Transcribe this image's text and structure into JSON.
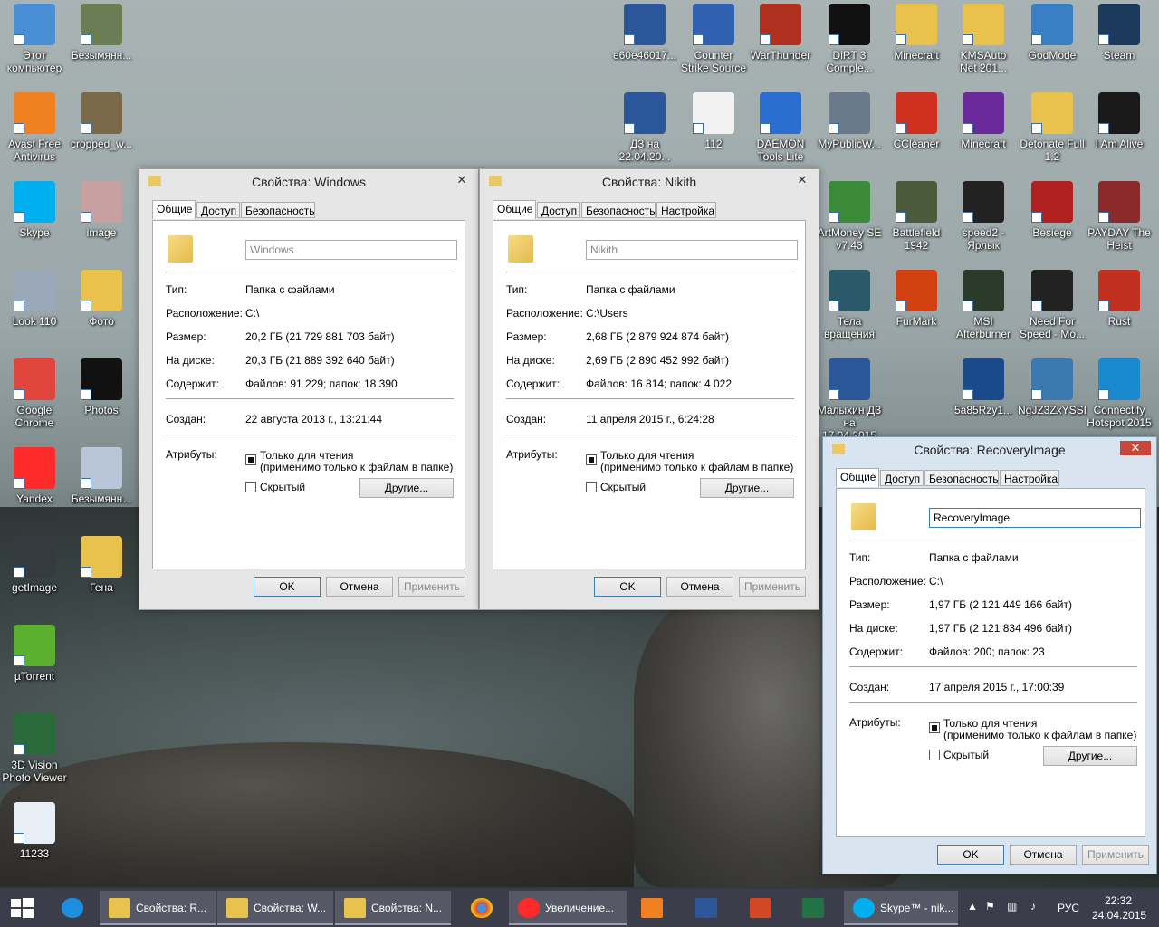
{
  "desktop": {
    "icons": [
      {
        "label": "Этот\nкомпьютер",
        "color": "#4a8fd6"
      },
      {
        "label": "Безымянн...",
        "color": "#6b7d55"
      },
      {
        "label": "Avast Free\nAntivirus",
        "color": "#f08020"
      },
      {
        "label": "cropped_w...",
        "color": "#7a6a4a"
      },
      {
        "label": "Skype",
        "color": "#00aff0"
      },
      {
        "label": "image",
        "color": "#c9a0a0"
      },
      {
        "label": "Look 110",
        "color": "#9aa8b8"
      },
      {
        "label": "Фото",
        "color": "#e9c24e"
      },
      {
        "label": "Google\nChrome",
        "color": "#e0463b"
      },
      {
        "label": "Photos",
        "color": "#111111"
      },
      {
        "label": "Yandex",
        "color": "#ff2b2b"
      },
      {
        "label": "Безымянн...",
        "color": "#b8c6d8"
      },
      {
        "label": "getImage",
        "color": "#333b40"
      },
      {
        "label": "Гена",
        "color": "#e9c24e"
      },
      {
        "label": "µTorrent",
        "color": "#5cb030"
      },
      {
        "label": "3D Vision\nPhoto Viewer",
        "color": "#2a6a3a"
      },
      {
        "label": "11233",
        "color": "#e8eef5"
      },
      {
        "label": "e60e46017...",
        "color": "#2b579a"
      },
      {
        "label": "Counter\nStrike Source",
        "color": "#3060b0"
      },
      {
        "label": "WarThunder",
        "color": "#b03020"
      },
      {
        "label": "DiRT 3\nComple...",
        "color": "#111111"
      },
      {
        "label": "Minecraft",
        "color": "#e9c24e"
      },
      {
        "label": "KMSAuto\nNet 201...",
        "color": "#e9c24e"
      },
      {
        "label": "GodMode",
        "color": "#3a7fc4"
      },
      {
        "label": "Steam",
        "color": "#1b3a5c"
      },
      {
        "label": "ДЗ на\n22.04.20...",
        "color": "#2b579a"
      },
      {
        "label": "112",
        "color": "#f2f2f2"
      },
      {
        "label": "DAEMON\nTools Lite",
        "color": "#2a6fd0"
      },
      {
        "label": "MyPublicW...",
        "color": "#6a7a8a"
      },
      {
        "label": "CCleaner",
        "color": "#d03020"
      },
      {
        "label": "Minecraft",
        "color": "#6a2a9a"
      },
      {
        "label": "Detonate Full\n1.2",
        "color": "#e9c24e"
      },
      {
        "label": "I Am Alive",
        "color": "#1a1a1a"
      },
      {
        "label": "ArtMoney SE\nv7.43",
        "color": "#3a8a3a"
      },
      {
        "label": "Battlefield\n1942",
        "color": "#4a5a3a"
      },
      {
        "label": "speed2 -\nЯрлык",
        "color": "#222222"
      },
      {
        "label": "Besiege",
        "color": "#b02020"
      },
      {
        "label": "PAYDAY The\nHeist",
        "color": "#8a2a2a"
      },
      {
        "label": "Тела\nвращения",
        "color": "#2a5a6a"
      },
      {
        "label": "FurMark",
        "color": "#d04010"
      },
      {
        "label": "MSI\nAfterburner",
        "color": "#2a3a2a"
      },
      {
        "label": "Need For\nSpeed - Mo...",
        "color": "#222222"
      },
      {
        "label": "Rust",
        "color": "#c03020"
      },
      {
        "label": "Малыхин ДЗ\nна 17.04.2015",
        "color": "#2b579a"
      },
      {
        "label": "5a85Rzy1...",
        "color": "#1a4a8a"
      },
      {
        "label": "NgJZ3ZxYSSI",
        "color": "#3a7ab0"
      },
      {
        "label": "Connectify\nHotspot 2015",
        "color": "#1a8ad0"
      }
    ]
  },
  "dialogs": {
    "windows": {
      "title": "Свойства: Windows",
      "tabs": [
        "Общие",
        "Доступ",
        "Безопасность"
      ],
      "name": "Windows",
      "type_label": "Тип:",
      "type": "Папка с файлами",
      "location_label": "Расположение:",
      "location": "C:\\",
      "size_label": "Размер:",
      "size": "20,2 ГБ (21 729 881 703 байт)",
      "ondisk_label": "На диске:",
      "ondisk": "20,3 ГБ (21 889 392 640 байт)",
      "contains_label": "Содержит:",
      "contains": "Файлов: 91 229; папок: 18 390",
      "created_label": "Создан:",
      "created": "22 августа 2013 г., 13:21:44",
      "attrs_label": "Атрибуты:",
      "readonly": "Только для чтения",
      "readonly_note": "(применимо только к файлам в папке)",
      "hidden": "Скрытый",
      "other": "Другие...",
      "ok": "OK",
      "cancel": "Отмена",
      "apply": "Применить"
    },
    "nikith": {
      "title": "Свойства: Nikith",
      "tabs": [
        "Общие",
        "Доступ",
        "Безопасность",
        "Настройка"
      ],
      "name": "Nikith",
      "type_label": "Тип:",
      "type": "Папка с файлами",
      "location_label": "Расположение:",
      "location": "C:\\Users",
      "size_label": "Размер:",
      "size": "2,68 ГБ (2 879 924 874 байт)",
      "ondisk_label": "На диске:",
      "ondisk": "2,69 ГБ (2 890 452 992 байт)",
      "contains_label": "Содержит:",
      "contains": "Файлов: 16 814; папок: 4 022",
      "created_label": "Создан:",
      "created": "11 апреля 2015 г., 6:24:28",
      "attrs_label": "Атрибуты:",
      "readonly": "Только для чтения",
      "readonly_note": "(применимо только к файлам в папке)",
      "hidden": "Скрытый",
      "other": "Другие...",
      "ok": "OK",
      "cancel": "Отмена",
      "apply": "Применить"
    },
    "recovery": {
      "title": "Свойства: RecoveryImage",
      "tabs": [
        "Общие",
        "Доступ",
        "Безопасность",
        "Настройка"
      ],
      "name": "RecoveryImage",
      "type_label": "Тип:",
      "type": "Папка с файлами",
      "location_label": "Расположение:",
      "location": "C:\\",
      "size_label": "Размер:",
      "size": "1,97 ГБ (2 121 449 166 байт)",
      "ondisk_label": "На диске:",
      "ondisk": "1,97 ГБ (2 121 834 496 байт)",
      "contains_label": "Содержит:",
      "contains": "Файлов: 200; папок: 23",
      "created_label": "Создан:",
      "created": "17 апреля 2015 г., 17:00:39",
      "attrs_label": "Атрибуты:",
      "readonly": "Только для чтения",
      "readonly_note": "(применимо только к файлам в папке)",
      "hidden": "Скрытый",
      "other": "Другие...",
      "ok": "OK",
      "cancel": "Отмена",
      "apply": "Применить"
    }
  },
  "taskbar": {
    "buttons": [
      {
        "label": "Свойства: R...",
        "color": "#e9c24e"
      },
      {
        "label": "Свойства: W...",
        "color": "#e9c24e"
      },
      {
        "label": "Свойства: N...",
        "color": "#e9c24e"
      },
      {
        "label": "Увеличение...",
        "color": "#ff2b2b"
      },
      {
        "label": "Skype™ - nik...",
        "color": "#00aff0"
      }
    ],
    "lang": "РУС",
    "time": "22:32",
    "date": "24.04.2015"
  }
}
